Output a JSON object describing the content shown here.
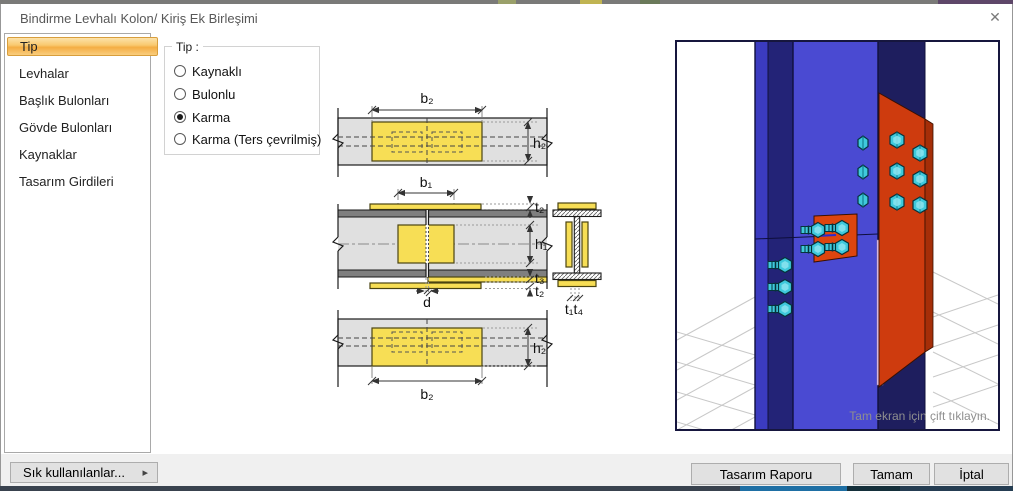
{
  "window": {
    "title": "Bindirme Levhalı Kolon/ Kiriş Ek Birleşimi",
    "close_glyph": "✕"
  },
  "sidebar": {
    "items": [
      {
        "label": "Tip",
        "selected": true
      },
      {
        "label": "Levhalar",
        "selected": false
      },
      {
        "label": "Başlık Bulonları",
        "selected": false
      },
      {
        "label": "Gövde Bulonları",
        "selected": false
      },
      {
        "label": "Kaynaklar",
        "selected": false
      },
      {
        "label": "Tasarım Girdileri",
        "selected": false
      }
    ]
  },
  "tip_group": {
    "title": "Tip :",
    "options": [
      {
        "label": "Kaynaklı",
        "selected": false
      },
      {
        "label": "Bulonlu",
        "selected": false
      },
      {
        "label": "Karma",
        "selected": true
      },
      {
        "label": "Karma (Ters çevrilmiş)",
        "selected": false
      }
    ]
  },
  "diagram": {
    "labels": {
      "b2_top": "b₂",
      "h2_top": "h₂",
      "b1": "b₁",
      "t2_top": "t₂",
      "h1": "h₁",
      "t3": "t₃",
      "t2_bottom": "t₂",
      "d": "d",
      "t1t4": "t₁t₄",
      "h2_bottom": "h₂",
      "b2_bottom": "b₂"
    }
  },
  "preview": {
    "caption": "Tam ekran için çift tıklayın."
  },
  "footer": {
    "favorites_label": "Sık kullanılanlar...",
    "favorites_arrow": "▸",
    "report_label": "Tasarım Raporu",
    "ok_label": "Tamam",
    "cancel_label": "İptal"
  },
  "colors": {
    "selected_item_orange": "#F5B14A",
    "plate_yellow": "#F7DE55",
    "beam_gray": "#E0E0E0",
    "flange_gray": "#7F7F7F",
    "column_blue": "#4A4AD2",
    "column_navy": "#1E1E5E",
    "splice_red": "#CE3B0E",
    "bolt_cyan": "#3FC9DC",
    "strip_pink": "#EFC6EF"
  }
}
